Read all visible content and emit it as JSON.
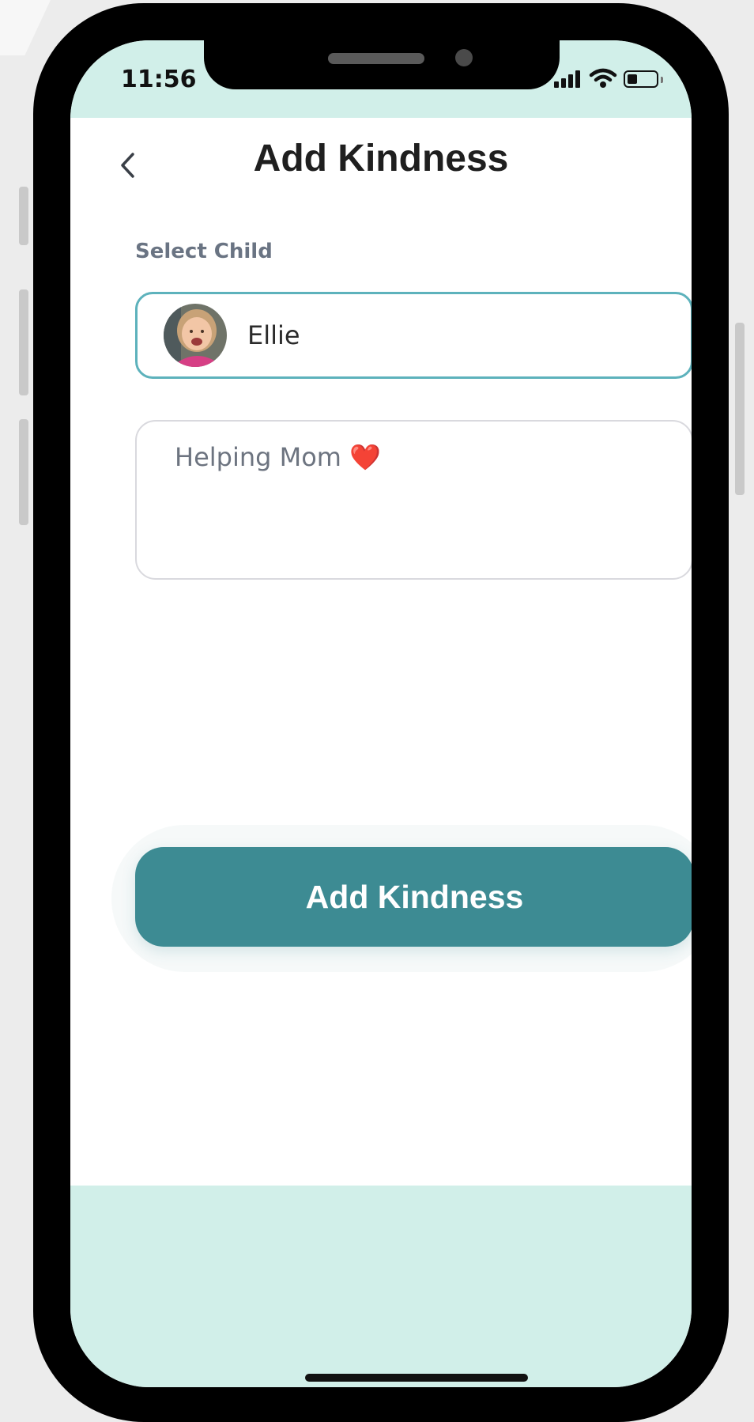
{
  "status_bar": {
    "time": "11:56",
    "icons": [
      "cellular-signal-icon",
      "wifi-icon",
      "battery-icon"
    ],
    "battery_level": 0.35
  },
  "header": {
    "title": "Add Kindness",
    "back_icon": "chevron-left-icon"
  },
  "form": {
    "select_child_label": "Select Child",
    "selected_child": {
      "name": "Ellie",
      "avatar": "child-photo"
    },
    "kindness_text": "Helping Mom ❤️",
    "submit_label": "Add Kindness"
  },
  "colors": {
    "accent_bg": "#d1efe9",
    "primary_button": "#3d8b93",
    "select_border": "#5db2bc",
    "label_text": "#6a7483"
  }
}
